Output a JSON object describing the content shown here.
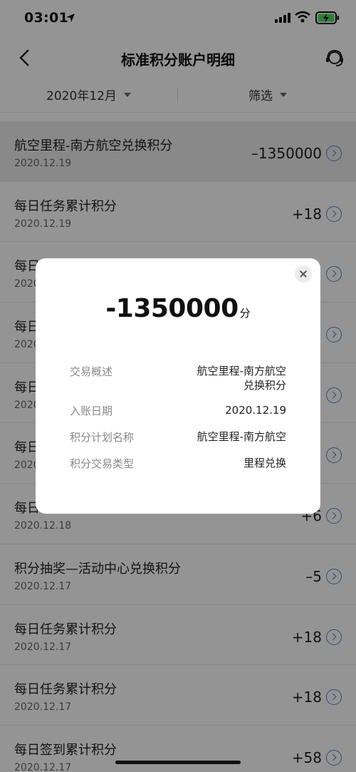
{
  "status_bar": {
    "time": "03:01"
  },
  "header": {
    "title": "标准积分账户明细"
  },
  "filters": {
    "month": "2020年12月",
    "filter": "筛选"
  },
  "transactions": [
    {
      "name": "航空里程-南方航空兑换积分",
      "date": "2020.12.19",
      "amount": "–1350000"
    },
    {
      "name": "每日任务累计积分",
      "date": "2020.12.19",
      "amount": "+18"
    },
    {
      "name": "每日",
      "date": "2020",
      "amount": ""
    },
    {
      "name": "每日",
      "date": "2020",
      "amount": ""
    },
    {
      "name": "每日",
      "date": "2020",
      "amount": ""
    },
    {
      "name": "每日",
      "date": "2020",
      "amount": ""
    },
    {
      "name": "每日",
      "date": "2020.12.18",
      "amount": "+6"
    },
    {
      "name": "积分抽奖—活动中心兑换积分",
      "date": "2020.12.17",
      "amount": "–5"
    },
    {
      "name": "每日任务累计积分",
      "date": "2020.12.17",
      "amount": "+18"
    },
    {
      "name": "每日任务累计积分",
      "date": "2020.12.17",
      "amount": "+18"
    },
    {
      "name": "每日签到累计积分",
      "date": "2020.12.17",
      "amount": "+58"
    }
  ],
  "modal": {
    "amount": "-1350000",
    "unit": "分",
    "details": [
      {
        "label": "交易概述",
        "value": "航空里程-南方航空兑换积分"
      },
      {
        "label": "入账日期",
        "value": "2020.12.19"
      },
      {
        "label": "积分计划名称",
        "value": "航空里程-南方航空"
      },
      {
        "label": "积分交易类型",
        "value": "里程兑换"
      }
    ]
  },
  "colors": {
    "accent": "#5b7fd6",
    "battery": "#4cd964"
  }
}
